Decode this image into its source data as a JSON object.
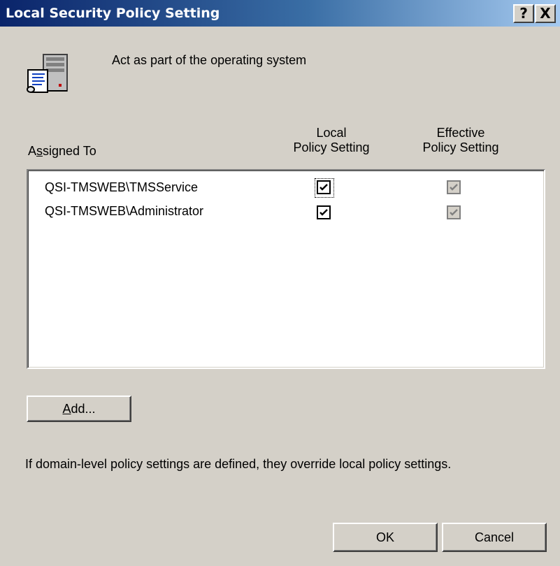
{
  "window": {
    "title": "Local Security Policy Setting",
    "help_button": "?",
    "close_button": "X"
  },
  "policy": {
    "icon": "policy-server-scroll-icon",
    "name": "Act as part of the operating system"
  },
  "columns": {
    "assigned_to_prefix": "A",
    "assigned_to_mnemonic": "s",
    "assigned_to_rest": "signed To",
    "local_line1": "Local",
    "local_line2": "Policy Setting",
    "effective_line1": "Effective",
    "effective_line2": "Policy Setting"
  },
  "assignments": [
    {
      "name": "QSI-TMSWEB\\TMSService",
      "local_checked": true,
      "effective_checked": true
    },
    {
      "name": "QSI-TMSWEB\\Administrator",
      "local_checked": true,
      "effective_checked": true
    }
  ],
  "buttons": {
    "add_mnemonic": "A",
    "add_rest": "dd...",
    "ok": "OK",
    "cancel": "Cancel"
  },
  "note": "If domain-level policy settings are defined, they override local policy settings.",
  "colors": {
    "title_start": "#0a246a",
    "title_end": "#a6caf0",
    "face": "#d4d0c8"
  }
}
